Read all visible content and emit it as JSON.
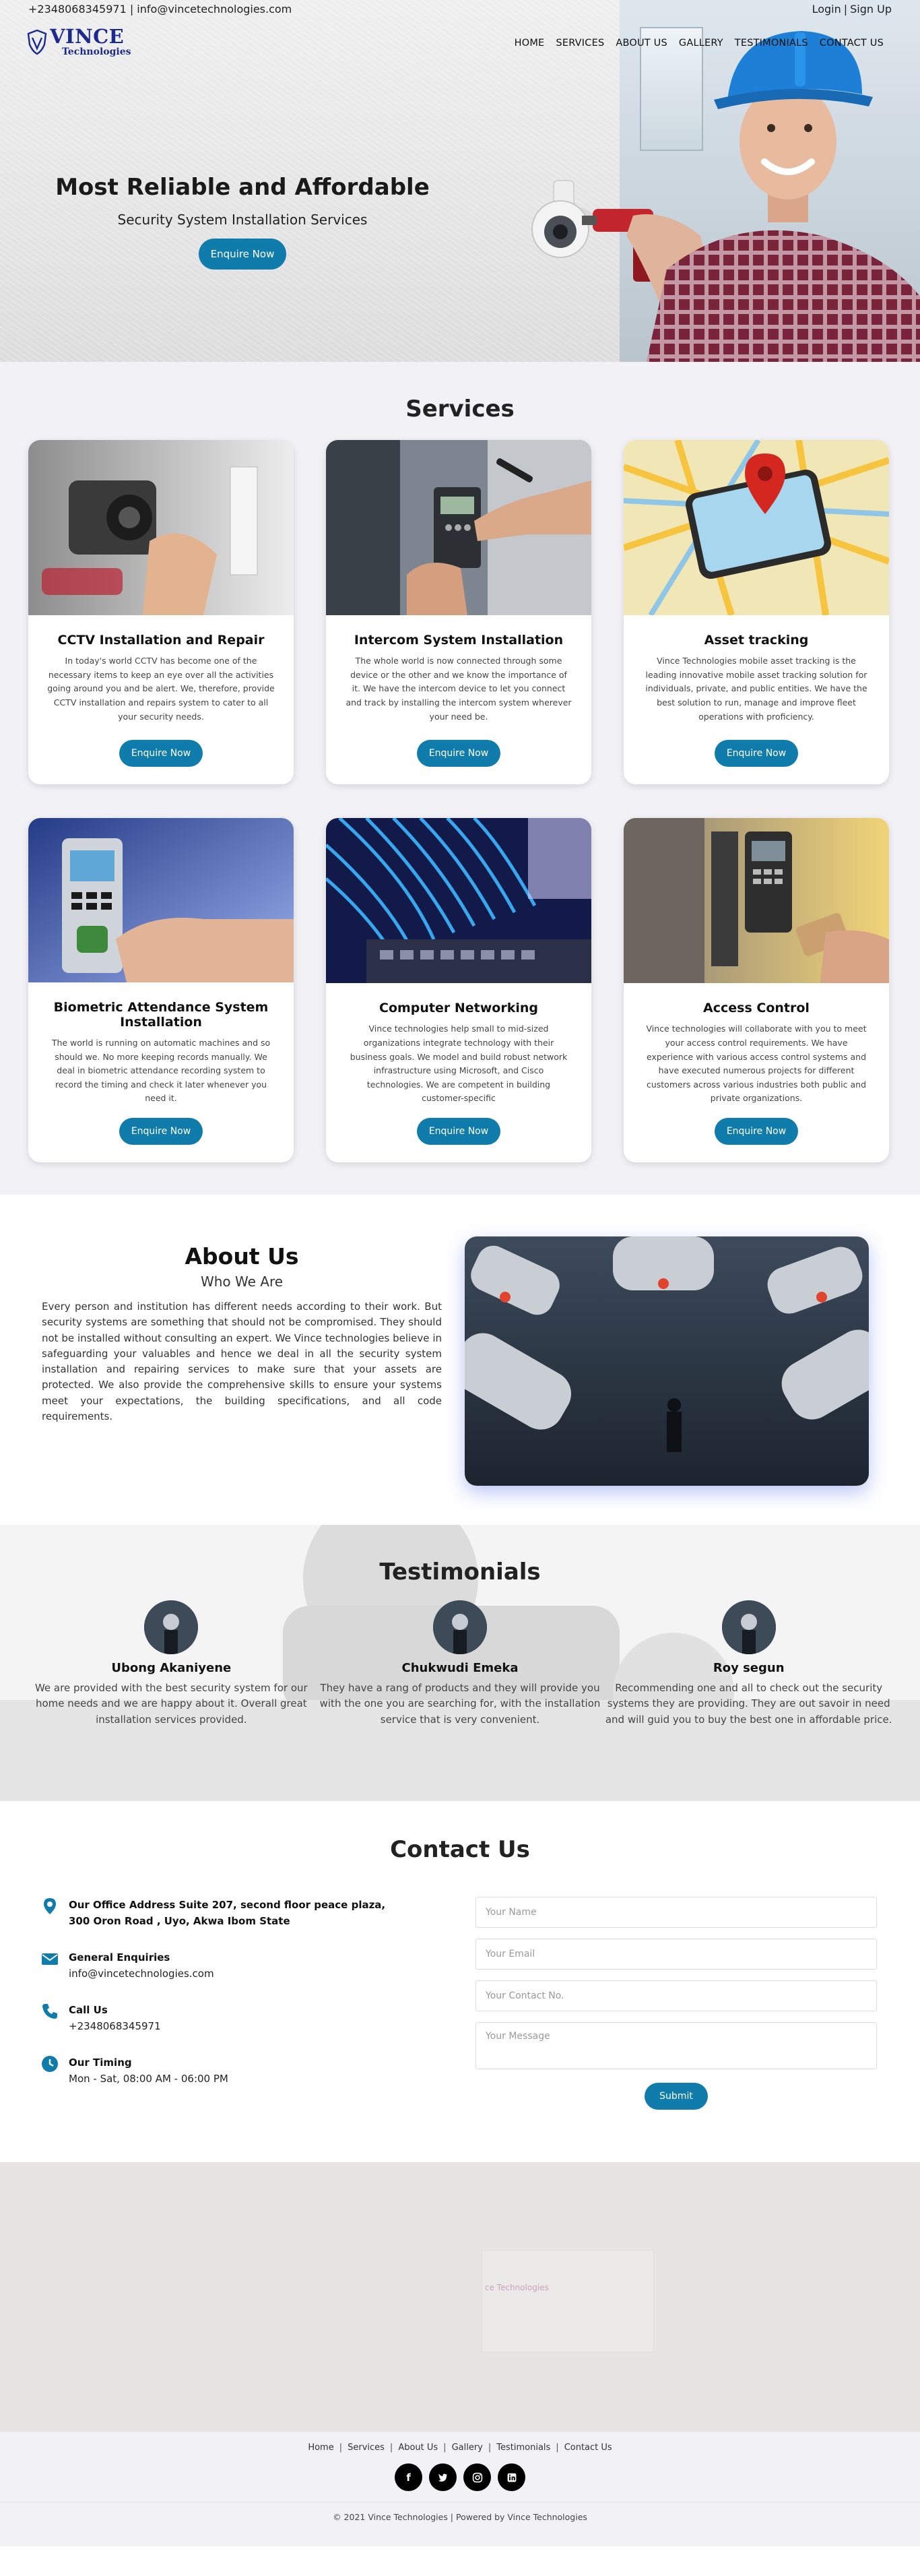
{
  "topbar": {
    "contact": "+2348068345971 | info@vincetechnologies.com",
    "login": "Login",
    "separator": "|",
    "signup": "Sign Up"
  },
  "logo": {
    "line1": "VINCE",
    "line2": "Technologies"
  },
  "nav": [
    "HOME",
    "SERVICES",
    "ABOUT US",
    "GALLERY",
    "TESTIMONIALS",
    "CONTACT US"
  ],
  "hero": {
    "title": "Most Reliable and Affordable",
    "subtitle": "Security System Installation Services",
    "button": "Enquire Now"
  },
  "services": {
    "title": "Services",
    "items": [
      {
        "title": "CCTV Installation and Repair",
        "text": "In today's world CCTV has become one of the necessary items to keep an eye over all the activities going around you and be alert. We, therefore, provide CCTV installation and repairs system to cater to all your security needs.",
        "button": "Enquire Now"
      },
      {
        "title": "Intercom System Installation",
        "text": "The whole world is now connected through some device or the other and we know the importance of it. We have the intercom device to let you connect and track by installing the intercom system wherever your need be.",
        "button": "Enquire Now"
      },
      {
        "title": "Asset tracking",
        "text": "Vince Technologies mobile asset tracking is the leading innovative mobile asset tracking solution for individuals, private, and public entities. We have the best solution to run, manage and improve fleet operations with proficiency.",
        "button": "Enquire Now"
      },
      {
        "title": "Biometric Attendance System Installation",
        "text": "The world is running on automatic machines and so should we. No more keeping records manually. We deal in biometric attendance recording system to record the timing and check it later whenever you need it.",
        "button": "Enquire Now"
      },
      {
        "title": "Computer Networking",
        "text": "Vince technologies help small to mid-sized organizations integrate technology with their business goals. We model and build robust network infrastructure using Microsoft, and Cisco technologies. We are competent in building customer-specific",
        "button": "Enquire Now"
      },
      {
        "title": "Access Control",
        "text": "Vince technologies will collaborate with you to meet your access control requirements. We have experience with various access control systems and have executed numerous projects for different customers across various industries both public and private organizations.",
        "button": "Enquire Now"
      }
    ]
  },
  "about": {
    "title": "About Us",
    "subtitle": "Who We Are",
    "text": "Every person and institution has different needs according to their work. But security systems are something that should not be compromised. They should not be installed without consulting an expert. We Vince technologies believe in safeguarding your valuables and hence we deal in all the security system installation and repairing services to make sure that your assets are protected. We also provide the comprehensive skills to ensure your systems meet your expectations, the building specifications, and all code requirements."
  },
  "testimonials": {
    "title": "Testimonials",
    "items": [
      {
        "name": "Ubong Akaniyene",
        "text": "We are provided with the best security system for our home needs and we are happy about it. Overall great installation services provided."
      },
      {
        "name": "Chukwudi Emeka",
        "text": "They have a rang of products and they will provide you with the one you are searching for, with the installation service that is very convenient."
      },
      {
        "name": "Roy segun",
        "text": "Recommending one and all to check out the security systems they are providing. They are out savoir in need and will guid you to buy the best one in affordable price."
      }
    ]
  },
  "contact": {
    "title": "Contact Us",
    "address": "Our Office Address Suite 207, second floor peace plaza, 300 Oron Road , Uyo, Akwa Ibom State",
    "enquiries_label": "General Enquiries",
    "enquiries_value": "info@vincetechnologies.com",
    "call_label": "Call Us",
    "call_value": "+2348068345971",
    "timing_label": "Our Timing",
    "timing_value": "Mon - Sat, 08:00 AM - 06:00 PM",
    "form": {
      "name": "Your Name",
      "email": "Your Email",
      "phone": "Your Contact No.",
      "message": "Your Message",
      "submit": "Submit"
    }
  },
  "map": {
    "label": "ce Technologies"
  },
  "footer": {
    "links": [
      "Home",
      "Services",
      "About Us",
      "Gallery",
      "Testimonials",
      "Contact Us"
    ],
    "social": [
      "f",
      "t",
      "ig",
      "in"
    ],
    "copyright": "© 2021 Vince Technologies | Powered by Vince Technologies"
  },
  "colors": {
    "accent": "#0f7cac",
    "brand": "#1b2a8c"
  }
}
